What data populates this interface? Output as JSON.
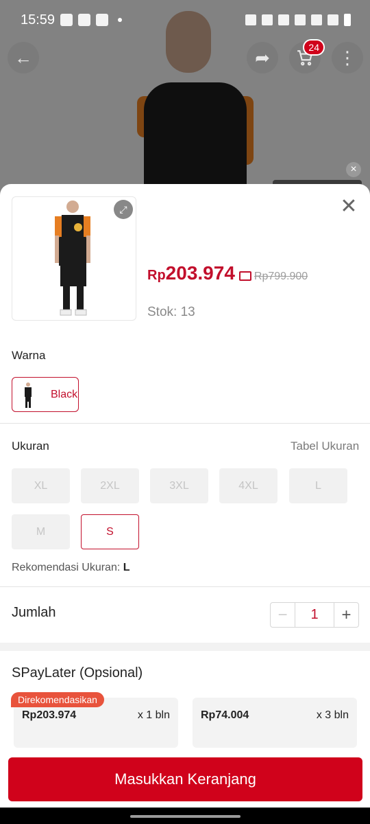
{
  "status_bar": {
    "time": "15:59"
  },
  "header": {
    "cart_count": "24"
  },
  "product": {
    "price_currency": "Rp",
    "price": "203.974",
    "original_price": "Rp799.900",
    "stock": "Stok: 13"
  },
  "variants": {
    "color_label": "Warna",
    "colors": [
      {
        "label": "Black"
      }
    ],
    "size_label": "Ukuran",
    "size_chart_link": "Tabel Ukuran",
    "sizes": [
      "XL",
      "2XL",
      "3XL",
      "4XL",
      "L",
      "M",
      "S"
    ],
    "selected_size": "S",
    "recommendation_label": "Rekomendasi Ukuran:",
    "recommendation_value": "L"
  },
  "quantity": {
    "label": "Jumlah",
    "minus": "−",
    "value": "1",
    "plus": "+"
  },
  "spaylater": {
    "title": "SPayLater (Opsional)",
    "badge": "Direkomendasikan",
    "options": [
      {
        "amount": "Rp203.974",
        "term": "x 1 bln"
      },
      {
        "amount": "Rp74.004",
        "term": "x 3 bln"
      }
    ]
  },
  "cta": {
    "add_to_cart": "Masukkan Keranjang"
  },
  "icons": {
    "back": "arrow-left-icon",
    "share": "share-icon",
    "cart": "cart-icon",
    "more": "more-vertical-icon",
    "close": "close-icon",
    "expand": "expand-icon",
    "voucher": "voucher-icon"
  },
  "colors": {
    "accent": "#c20f2c",
    "cta": "#d0021b",
    "badge": "#e8533c"
  }
}
